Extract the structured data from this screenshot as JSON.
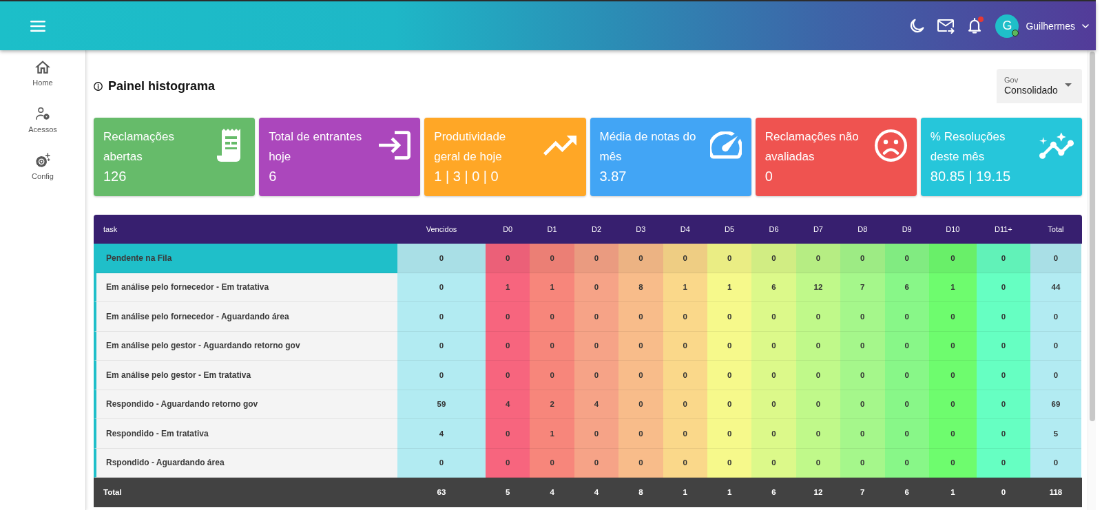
{
  "topbar": {
    "notifications": {
      "unread": true
    },
    "user": {
      "initial": "G",
      "name": "Guilhermes",
      "online": true
    }
  },
  "sidebar": {
    "items": [
      {
        "label": "Home"
      },
      {
        "label": "Acessos"
      },
      {
        "label": "Config"
      }
    ]
  },
  "page": {
    "title": "Painel histograma",
    "filter": {
      "label": "Gov",
      "value": "Consolidado"
    }
  },
  "cards": [
    {
      "title": "Reclamações abertas",
      "value": "126",
      "color": "#66bb6a"
    },
    {
      "title": "Total de entrantes hoje",
      "value": "6",
      "color": "#ab47bc"
    },
    {
      "title": "Produtividade geral de hoje",
      "value": "1 | 3 | 0 | 0",
      "color": "#ffa726"
    },
    {
      "title": "Média de notas do mês",
      "value": "3.87",
      "color": "#42a5f5"
    },
    {
      "title": "Reclamações não avaliadas",
      "value": "0",
      "color": "#ef5350"
    },
    {
      "title": "% Resoluções deste mês",
      "value": "80.85 | 19.15",
      "color": "#26c6da"
    }
  ],
  "table": {
    "columns": [
      {
        "label": "task"
      },
      {
        "label": "Vencidos",
        "color": "#b2ebf2"
      },
      {
        "label": "D0",
        "color": "#f7657e"
      },
      {
        "label": "D1",
        "color": "#f7867b"
      },
      {
        "label": "D2",
        "color": "#f6a387"
      },
      {
        "label": "D3",
        "color": "#f8bc8a"
      },
      {
        "label": "D4",
        "color": "#fad88a"
      },
      {
        "label": "D5",
        "color": "#f6f98b"
      },
      {
        "label": "D6",
        "color": "#dcf98a"
      },
      {
        "label": "D7",
        "color": "#c0f98a"
      },
      {
        "label": "D8",
        "color": "#a5f78b"
      },
      {
        "label": "D9",
        "color": "#88f788"
      },
      {
        "label": "D10",
        "color": "#6efc6e"
      },
      {
        "label": "D11+",
        "color": "#66ffc2"
      },
      {
        "label": "Total",
        "color": "#b2ebf2"
      }
    ],
    "rows": [
      {
        "task": "Pendente na Fila",
        "selected": true,
        "values": [
          "0",
          "0",
          "0",
          "0",
          "0",
          "0",
          "0",
          "0",
          "0",
          "0",
          "0",
          "0",
          "0",
          "0"
        ]
      },
      {
        "task": "Em análise pelo fornecedor - Em tratativa",
        "selected": false,
        "values": [
          "0",
          "1",
          "1",
          "0",
          "8",
          "1",
          "1",
          "6",
          "12",
          "7",
          "6",
          "1",
          "0",
          "44"
        ]
      },
      {
        "task": "Em análise pelo fornecedor - Aguardando área",
        "selected": false,
        "values": [
          "0",
          "0",
          "0",
          "0",
          "0",
          "0",
          "0",
          "0",
          "0",
          "0",
          "0",
          "0",
          "0",
          "0"
        ]
      },
      {
        "task": "Em análise pelo gestor - Aguardando retorno gov",
        "selected": false,
        "values": [
          "0",
          "0",
          "0",
          "0",
          "0",
          "0",
          "0",
          "0",
          "0",
          "0",
          "0",
          "0",
          "0",
          "0"
        ]
      },
      {
        "task": "Em análise pelo gestor - Em tratativa",
        "selected": false,
        "values": [
          "0",
          "0",
          "0",
          "0",
          "0",
          "0",
          "0",
          "0",
          "0",
          "0",
          "0",
          "0",
          "0",
          "0"
        ]
      },
      {
        "task": "Respondido - Aguardando retorno gov",
        "selected": false,
        "values": [
          "59",
          "4",
          "2",
          "4",
          "0",
          "0",
          "0",
          "0",
          "0",
          "0",
          "0",
          "0",
          "0",
          "69"
        ]
      },
      {
        "task": "Respondido - Em tratativa",
        "selected": false,
        "values": [
          "4",
          "0",
          "1",
          "0",
          "0",
          "0",
          "0",
          "0",
          "0",
          "0",
          "0",
          "0",
          "0",
          "5"
        ]
      },
      {
        "task": "Rspondido - Aguardando área",
        "selected": false,
        "values": [
          "0",
          "0",
          "0",
          "0",
          "0",
          "0",
          "0",
          "0",
          "0",
          "0",
          "0",
          "0",
          "0",
          "0"
        ]
      }
    ],
    "total": {
      "label": "Total",
      "values": [
        "63",
        "5",
        "4",
        "4",
        "8",
        "1",
        "1",
        "6",
        "12",
        "7",
        "6",
        "1",
        "0",
        "118"
      ]
    }
  }
}
